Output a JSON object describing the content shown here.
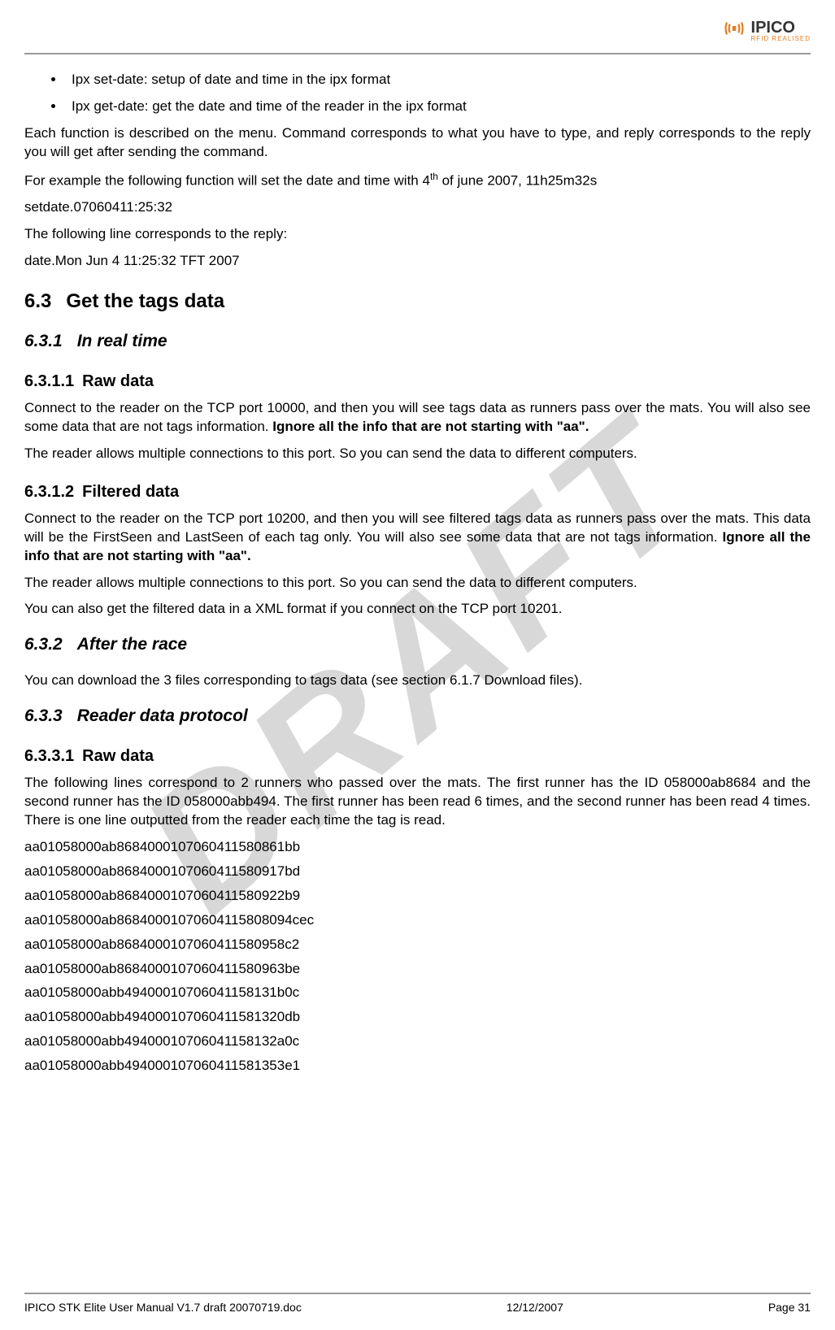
{
  "header": {
    "logo_name": "IPICO",
    "logo_tagline": "RFID REALISED"
  },
  "watermark": "DRAFT",
  "bullets": [
    "Ipx set-date: setup of date and time in the ipx format",
    "Ipx get-date: get the date and time of the reader in the ipx format"
  ],
  "intro": {
    "p1": "Each function is described on the menu. Command corresponds to what you have to type, and reply corresponds to the reply you will get after sending the command.",
    "p2a": "For example the following function will set the date and time with 4",
    "p2sup": "th",
    "p2b": " of june 2007, 11h25m32s",
    "p3": "setdate.07060411:25:32",
    "p4": "The following line corresponds to the reply:",
    "p5": "date.Mon Jun  4 11:25:32 TFT 2007"
  },
  "s63": {
    "num": "6.3",
    "title": "Get the tags data"
  },
  "s631": {
    "num": "6.3.1",
    "title": "In real time"
  },
  "s6311": {
    "num": "6.3.1.1",
    "title": "Raw data",
    "p1a": "Connect to the reader on the TCP port 10000, and then you will see tags data as runners pass over the mats. You will also see some data that are not tags information. ",
    "p1b": "Ignore all the info that are not starting with \"aa\".",
    "p2": "The reader allows multiple connections to this port. So you can send the data to different computers."
  },
  "s6312": {
    "num": "6.3.1.2",
    "title": "Filtered data",
    "p1a": "Connect to the reader on the TCP port 10200, and then you will see filtered tags data as runners pass over the mats. This data will be the FirstSeen and LastSeen of each tag only. You will also see some data that are not tags information. ",
    "p1b": "Ignore all the info that are not starting with \"aa\".",
    "p2": "The reader allows multiple connections to this port. So you can send the data to different computers.",
    "p3": "You can also get the filtered data in a XML format if you connect on the TCP port 10201."
  },
  "s632": {
    "num": "6.3.2",
    "title": "After the race",
    "p1": "You can download the 3 files corresponding to tags data (see section 6.1.7 Download files)."
  },
  "s633": {
    "num": "6.3.3",
    "title": "Reader data protocol"
  },
  "s6331": {
    "num": "6.3.3.1",
    "title": "Raw data",
    "p1": "The following lines correspond to 2 runners who passed over the mats. The first runner has the ID 058000ab8684 and the second runner has the ID 058000abb494. The first runner has been read 6 times, and the second runner has been read 4 times. There is one line outputted from the reader each time the tag is read."
  },
  "datalines": [
    "aa01058000ab8684000107060411580861bb",
    "aa01058000ab8684000107060411580917bd",
    "aa01058000ab8684000107060411580922b9",
    "aa01058000ab86840001070604115808094cec",
    "aa01058000ab8684000107060411580958c2",
    "aa01058000ab8684000107060411580963be",
    "aa01058000abb49400010706041158131b0c",
    "aa01058000abb494000107060411581320db",
    "aa01058000abb49400010706041158132a0c",
    "aa01058000abb494000107060411581353e1"
  ],
  "footer": {
    "left": "IPICO STK Elite User Manual V1.7 draft 20070719.doc",
    "center": "12/12/2007",
    "right": "Page 31"
  }
}
